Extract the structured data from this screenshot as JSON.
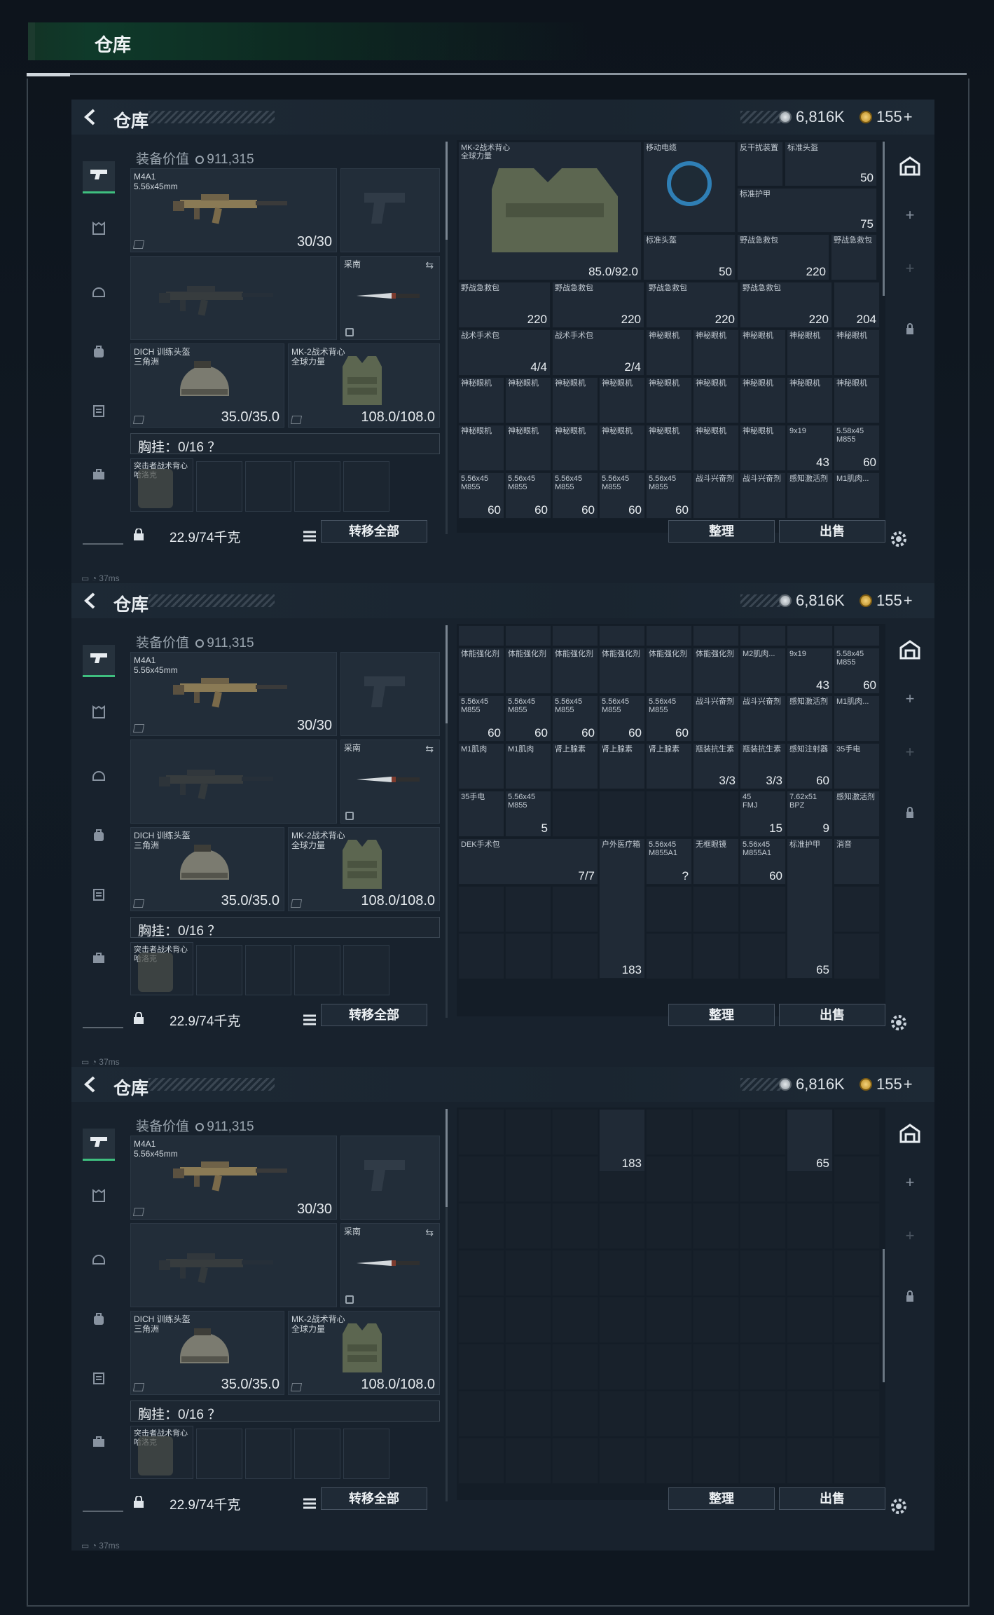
{
  "app": {
    "title": "仓库"
  },
  "panels": [
    {
      "id": 1
    },
    {
      "id": 2
    },
    {
      "id": 3
    }
  ],
  "header": {
    "title": "仓库",
    "currency1": "6,816K",
    "currency2": "155"
  },
  "equip": {
    "value_label": "装备价值",
    "value": "911,315",
    "weapon_name": "M4A1",
    "weapon_ammo": "5.56x45mm",
    "weapon_count": "30/30",
    "melee_name": "采南",
    "helmet_name": "DICH 训练头盔",
    "helmet_sub": "三角洲",
    "helmet_count": "35.0/35.0",
    "armor_name": "MK-2战术背心",
    "armor_sub": "全球力量",
    "armor_count": "108.0/108.0",
    "rig_label": "胸挂：0/16 ？",
    "bag_name": "突击者战术背心",
    "bag_sub": "哈洛克",
    "weight": "22.9/74千克",
    "transfer_btn": "转移全部",
    "sort_btn": "整理",
    "sell_btn": "出售",
    "ping": "37ms"
  },
  "colors": {
    "accent": "#3fbf7f",
    "bg": "#18222d",
    "cell": "#202a36"
  },
  "grid1": [
    {
      "t": "MK-2战术背心\n全球力量",
      "n": "85.0/92.0"
    },
    {
      "t": "移动电缆",
      "n": ""
    },
    {
      "t": "反干扰装置",
      "n": ""
    },
    {
      "t": "标准头盔",
      "n": "50"
    },
    {
      "t": "标准护甲",
      "n": "75"
    },
    {
      "t": "标准头盔",
      "n": "50"
    },
    {
      "t": "野战急救包",
      "n": "220"
    },
    {
      "t": "野战急救包",
      "n": ""
    },
    {
      "t": "野战急救包",
      "n": "220"
    },
    {
      "t": "野战急救包",
      "n": "220"
    },
    {
      "t": "野战急救包",
      "n": "220"
    },
    {
      "t": "野战急救包",
      "n": "220"
    },
    {
      "t": "",
      "n": "204"
    },
    {
      "t": "战术手术包",
      "n": "4/4"
    },
    {
      "t": "战术手术包",
      "n": "2/4"
    },
    {
      "t": "神秘眼机",
      "n": ""
    },
    {
      "t": "9x19",
      "n": "43"
    },
    {
      "t": "5.58x45\nM855",
      "n": "60"
    },
    {
      "t": "5.56x45\nM855",
      "n": "60"
    },
    {
      "t": "战斗兴奋剂",
      "n": ""
    },
    {
      "t": "感知激活剂",
      "n": ""
    },
    {
      "t": "M1肌肉...",
      "n": ""
    }
  ],
  "grid2": [
    {
      "t": "体能强化剂",
      "n": ""
    },
    {
      "t": "M2肌肉...",
      "n": ""
    },
    {
      "t": "9x19",
      "n": "43"
    },
    {
      "t": "5.58x45\nM855",
      "n": "60"
    },
    {
      "t": "5.56x45\nM855",
      "n": "60"
    },
    {
      "t": "战斗兴奋剂",
      "n": ""
    },
    {
      "t": "感知激活剂",
      "n": ""
    },
    {
      "t": "M1肌肉...",
      "n": ""
    },
    {
      "t": "M1肌肉",
      "n": ""
    },
    {
      "t": "肾上腺素",
      "n": ""
    },
    {
      "t": "瓶装抗生素",
      "n": "3/3"
    },
    {
      "t": "感知注射器",
      "n": "60"
    },
    {
      "t": "35手电",
      "n": ""
    },
    {
      "t": "5.56x45\nM855",
      "n": "5"
    },
    {
      "t": "45\nFMJ",
      "n": "15"
    },
    {
      "t": "7.62x51\nBPZ",
      "n": "9"
    },
    {
      "t": "感知激活剂",
      "n": ""
    },
    {
      "t": "DEK手术包",
      "n": "7/7"
    },
    {
      "t": "户外医疗箱",
      "n": "183"
    },
    {
      "t": "5.56x45\nM855A1",
      "n": "?"
    },
    {
      "t": "无框眼镜",
      "n": ""
    },
    {
      "t": "5.56x45\nM855A1",
      "n": "60"
    },
    {
      "t": "标准护甲",
      "n": "65"
    },
    {
      "t": "消音",
      "n": ""
    }
  ],
  "grid3": [
    {
      "t": "",
      "n": "183"
    },
    {
      "t": "",
      "n": "65"
    }
  ]
}
